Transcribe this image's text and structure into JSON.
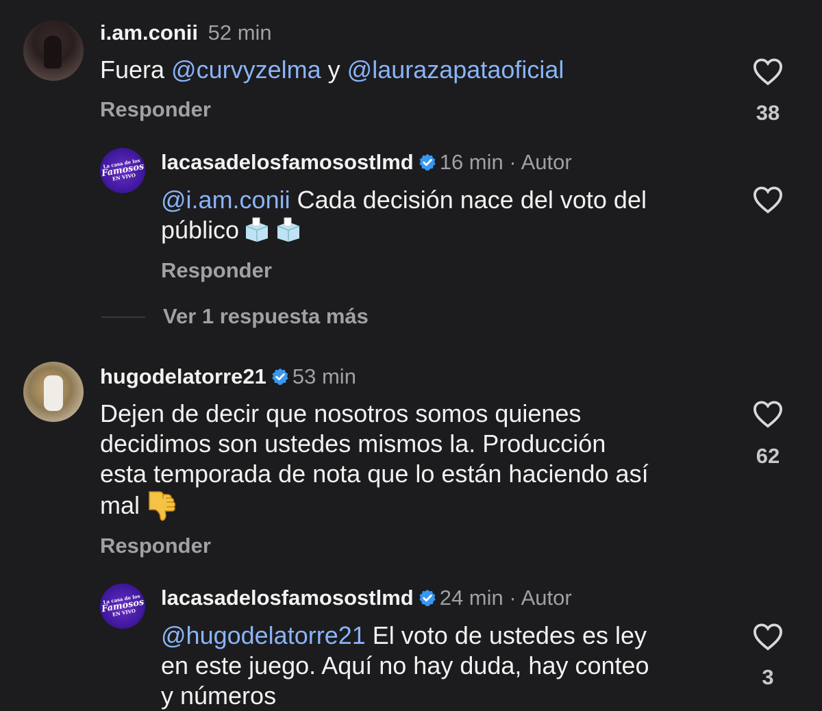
{
  "comments": [
    {
      "username": "i.am.conii",
      "time": "52 min",
      "text_pre": "Fuera ",
      "mention1": "@curvyzelma",
      "text_mid": " y ",
      "mention2": "@laurazapataoficial",
      "reply_label": "Responder",
      "likes": "38",
      "avatar": "profile-photo"
    },
    {
      "username": "lacasadelosfamosostlmd",
      "time": "16 min",
      "separator": " · ",
      "author_label": "Autor",
      "mention": "@i.am.conii",
      "text_line1": " Cada decisión nace del voto del",
      "text_line2": "público",
      "emojis": "ballot-box-icon ballot-box-icon",
      "reply_label": "Responder",
      "more_replies": "Ver 1 respuesta más",
      "logo_text": [
        "La casa de los",
        "Famosos",
        "EN VIVO"
      ]
    },
    {
      "username": "hugodelatorre21",
      "time": "53 min",
      "text_lines": [
        "Dejen de decir que nosotros somos quienes",
        "decidimos son ustedes mismos la. Producción",
        "esta temporada de nota que lo están haciendo así",
        "mal"
      ],
      "emoji": "thumbs-down-icon",
      "reply_label": "Responder",
      "likes": "62"
    },
    {
      "username": "lacasadelosfamosostlmd",
      "time": "24 min",
      "separator": " · ",
      "author_label": "Autor",
      "mention": "@hugodelatorre21",
      "text_line1": " El voto de ustedes es ley",
      "text_line2": "en este juego. Aquí no hay duda, hay conteo",
      "text_line3": "y números",
      "likes": "3"
    }
  ],
  "colors": {
    "background": "#1c1c1e",
    "mention": "#8ab4f8",
    "verified": "#3897f0",
    "secondary_text": "#a0a0a5"
  }
}
